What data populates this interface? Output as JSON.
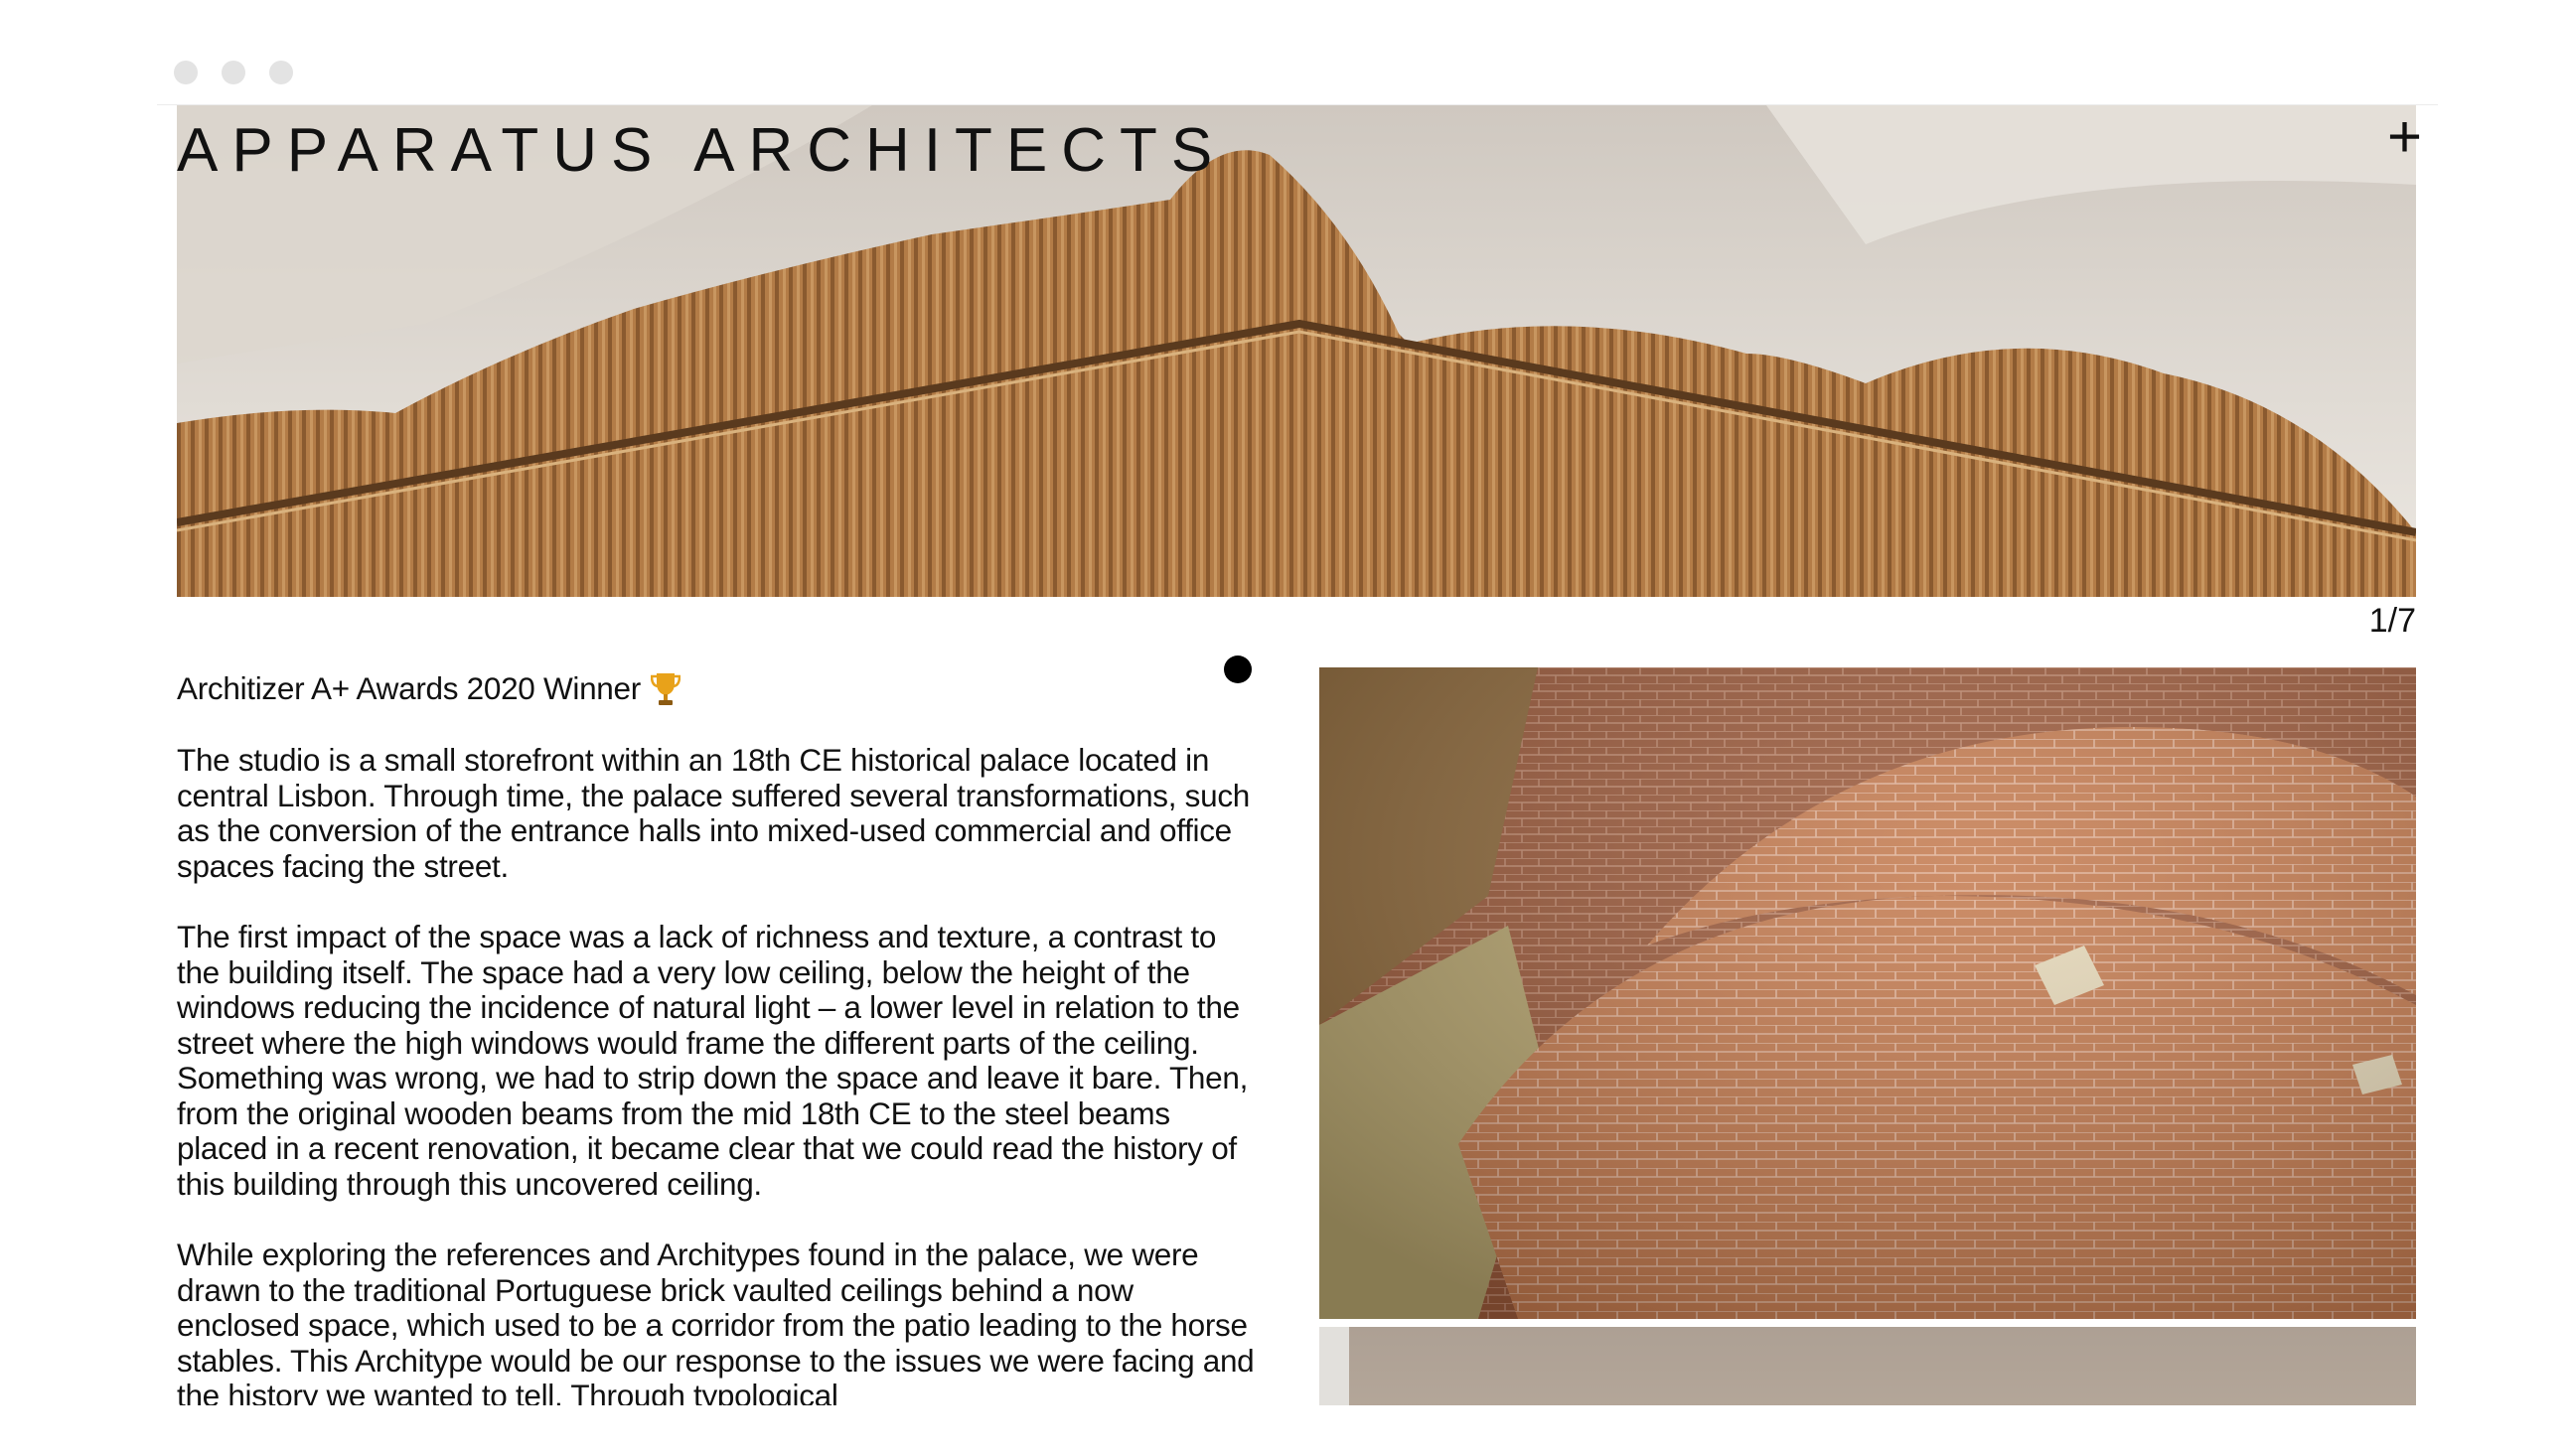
{
  "header": {
    "brand": "APPARATUS ARCHITECTS",
    "menu_icon": "plus-icon"
  },
  "gallery": {
    "counter": "1/7"
  },
  "article": {
    "award": "Architizer A+ Awards 2020 Winner",
    "award_icon": "trophy-icon",
    "paragraphs": [
      "The studio is a small storefront within an 18th CE historical palace located in central Lisbon. Through time, the palace suffered several transformations, such as the conversion of the entrance halls into mixed-used commercial and office spaces facing the street.",
      "The first impact of the space was a lack of richness and texture, a contrast to the building itself. The space had a very low ceiling, below the height of the windows reducing the incidence of natural light – a lower level in relation to the street where the high windows would frame the different parts of the ceiling. Something was wrong, we had to strip down the space and leave it bare. Then, from the original wooden beams from the mid 18th CE to the steel beams placed in a recent renovation, it became clear that we could read the history of this building through this uncovered ceiling.",
      "While exploring the references and Architypes found in the palace, we were drawn to the traditional Portuguese brick vaulted ceilings behind a now enclosed space, which used to be a corridor from the patio leading to the horse stables. This Architype would be our response to the issues we were facing and the history we wanted to tell. Through typological"
    ]
  },
  "colors": {
    "wood": "#b07a45",
    "ceiling": "#e8e3dc",
    "brick": "#c47a4e"
  }
}
